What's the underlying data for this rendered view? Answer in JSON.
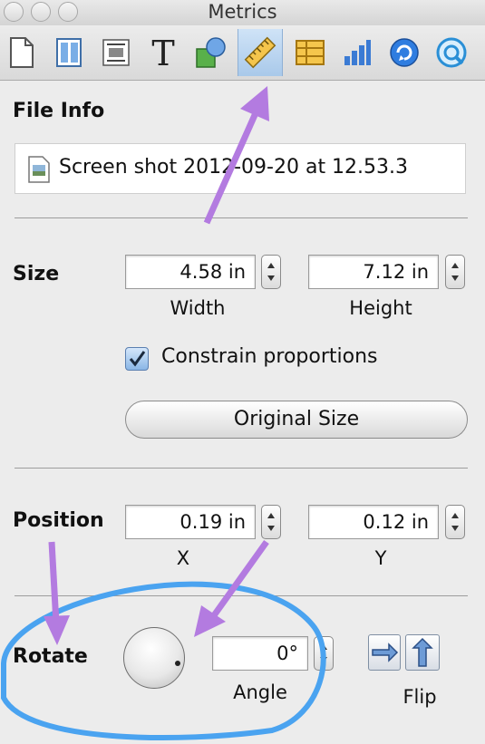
{
  "window": {
    "title": "Metrics"
  },
  "toolbar": {
    "tools": [
      {
        "name": "document",
        "icon": "document-icon"
      },
      {
        "name": "layout",
        "icon": "layout-icon"
      },
      {
        "name": "wrap",
        "icon": "wrap-icon"
      },
      {
        "name": "text",
        "icon": "text-icon",
        "glyph": "T"
      },
      {
        "name": "graphic",
        "icon": "shapes-icon"
      },
      {
        "name": "metrics",
        "icon": "ruler-icon",
        "selected": true
      },
      {
        "name": "table",
        "icon": "table-icon"
      },
      {
        "name": "chart",
        "icon": "bar-chart-icon"
      },
      {
        "name": "link",
        "icon": "link-icon"
      },
      {
        "name": "quicktime",
        "icon": "quicktime-icon"
      }
    ]
  },
  "file_info": {
    "label": "File Info",
    "filename": "Screen shot 2012-09-20 at 12.53.3"
  },
  "size": {
    "label": "Size",
    "width_value": "4.58 in",
    "height_value": "7.12 in",
    "width_caption": "Width",
    "height_caption": "Height",
    "constrain_label": "Constrain proportions",
    "constrain_checked": true,
    "original_size_label": "Original Size"
  },
  "position": {
    "label": "Position",
    "x_value": "0.19 in",
    "y_value": "0.12 in",
    "x_caption": "X",
    "y_caption": "Y"
  },
  "rotate": {
    "label": "Rotate",
    "angle_value": "0°",
    "angle_caption": "Angle",
    "flip_caption": "Flip"
  },
  "annotations": {
    "arrow_color": "#b37be0",
    "ellipse_color": "#4aa3f0"
  }
}
